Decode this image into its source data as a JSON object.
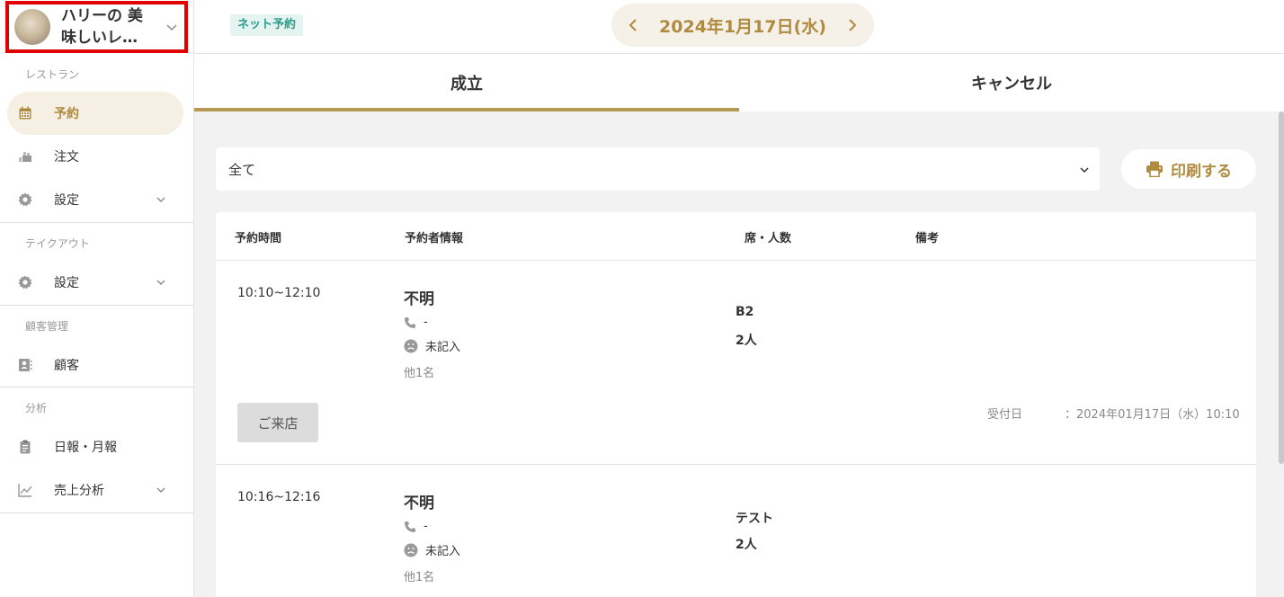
{
  "store": {
    "name_line1": "ハリーの 美",
    "name_line2": "味しいレ…"
  },
  "sidebar": {
    "sections": [
      {
        "label": "レストラン"
      },
      {
        "label": "テイクアウト"
      },
      {
        "label": "顧客管理"
      },
      {
        "label": "分析"
      }
    ],
    "items": [
      {
        "label": "予約",
        "icon": "calendar-icon",
        "active": true
      },
      {
        "label": "注文",
        "icon": "order-icon"
      },
      {
        "label": "設定",
        "icon": "gear-icon"
      },
      {
        "label": "設定",
        "icon": "gear-icon"
      },
      {
        "label": "顧客",
        "icon": "contact-card-icon"
      },
      {
        "label": "日報・月報",
        "icon": "clipboard-icon"
      },
      {
        "label": "売上分析",
        "icon": "chart-line-icon"
      }
    ]
  },
  "topbar": {
    "badge": "ネット予約",
    "date": "2024年1月17日(水)"
  },
  "tabs": [
    {
      "label": "成立",
      "active": true
    },
    {
      "label": "キャンセル"
    }
  ],
  "filter": {
    "value": "全て"
  },
  "print_label": "印刷する",
  "table": {
    "headers": [
      "予約時間",
      "予約者情報",
      "席・人数",
      "備考"
    ],
    "rows": [
      {
        "time": "10:10~12:10",
        "name": "不明",
        "phone": "-",
        "mood": "未記入",
        "others": "他1名",
        "seat": "B2",
        "count": "2人",
        "button": "ご来店",
        "received_label": "受付日",
        "received_value": "：2024年01月17日（水）10:10"
      },
      {
        "time": "10:16~12:16",
        "name": "不明",
        "phone": "-",
        "mood": "未記入",
        "others": "他1名",
        "seat": "テスト",
        "count": "2人"
      }
    ]
  },
  "colors": {
    "accent": "#b08a3e",
    "badge": "#2a9d8a",
    "highlight_border": "#e00000"
  }
}
